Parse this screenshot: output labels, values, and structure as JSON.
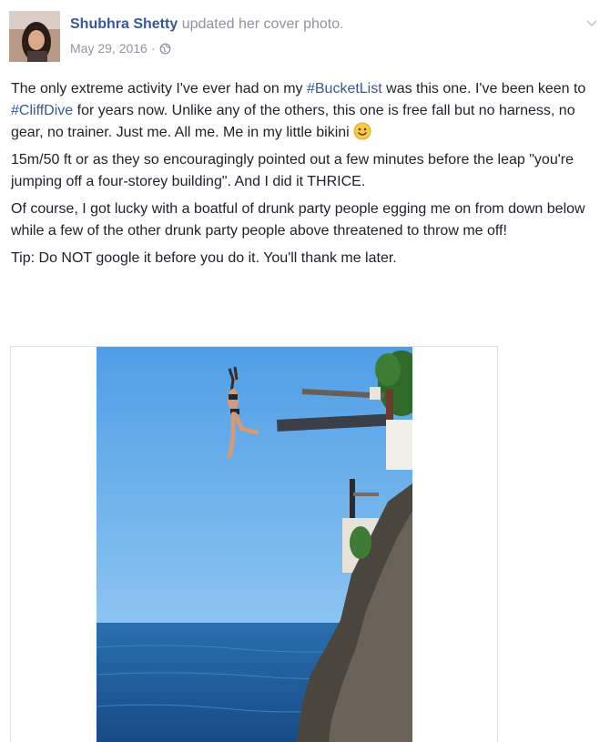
{
  "post": {
    "author": "Shubhra Shetty",
    "action": "updated her cover photo.",
    "date": "May 29, 2016",
    "separator": "·",
    "privacy_icon": "globe-icon",
    "menu_icon": "chevron-down-icon",
    "paragraphs": [
      {
        "segments": [
          {
            "text": "The only extreme activity I've ever had on my ",
            "tag": false
          },
          {
            "text": "#BucketList",
            "tag": true
          },
          {
            "text": " was this one. I've been keen to ",
            "tag": false
          },
          {
            "text": "#CliffDive",
            "tag": true
          },
          {
            "text": " for years now. Unlike any of the others, this one is free fall but no harness, no gear, no trainer. Just me. All me. Me in my little bikini",
            "tag": false
          }
        ],
        "emoji": "smiley-icon"
      },
      {
        "segments": [
          {
            "text": "15m/50 ft or as they so encouragingly pointed out a few minutes before the leap \"you're jumping off a four-storey building\". And I did it THRICE.",
            "tag": false
          }
        ]
      },
      {
        "segments": [
          {
            "text": "Of course, I got lucky with a boatful of drunk party people egging me on from down below while a few of the other drunk party people above threatened to throw me off!",
            "tag": false
          }
        ]
      },
      {
        "segments": [
          {
            "text": "Tip: Do NOT google it before you do it. You'll thank me later.",
            "tag": false
          }
        ]
      }
    ]
  },
  "colors": {
    "link": "#365899",
    "text": "#1d2129",
    "meta": "#90949c",
    "sky": "#5aa5e6",
    "sea": "#1f5f9e"
  }
}
